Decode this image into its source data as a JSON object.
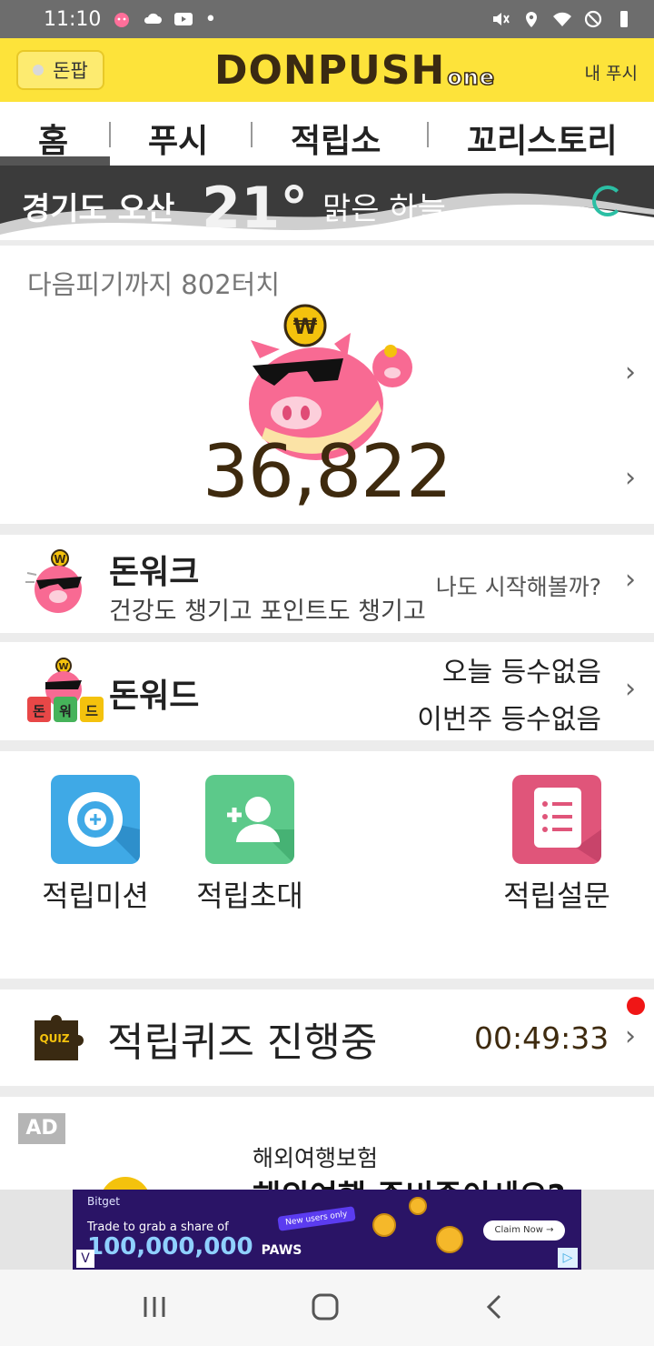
{
  "status_bar": {
    "time": "11:10",
    "notification_dot": "•"
  },
  "header": {
    "donpop_label": "돈팝",
    "logo_main": "DONPUSH",
    "logo_suffix": "one",
    "my_push_label": "내 푸시"
  },
  "tabs": [
    {
      "label": "홈",
      "active": true
    },
    {
      "label": "푸시"
    },
    {
      "label": "적립소"
    },
    {
      "label": "꼬리스토리"
    }
  ],
  "weather": {
    "location": "경기도 오산",
    "temperature": "21°",
    "description": "맑은 하늘"
  },
  "pig": {
    "next_pig_text": "다음피기까지 802터치",
    "points": "36,822",
    "coin_symbol": "₩"
  },
  "donwalk": {
    "title": "돈워크",
    "subtitle": "건강도 챙기고 포인트도 챙기고",
    "right_text": "나도 시작해볼까?",
    "coin_symbol": "W"
  },
  "donword": {
    "title": "돈워드",
    "today_text": "오늘 등수없음",
    "week_text": "이번주 등수없음",
    "tiles": [
      "돈",
      "워",
      "드"
    ],
    "coin_symbol": "W"
  },
  "earn_items": [
    {
      "label": "적립미션"
    },
    {
      "label": "적립초대"
    },
    {
      "label": "적립설문"
    }
  ],
  "quiz": {
    "badge": "QUIZ",
    "title": "적립퀴즈 진행중",
    "timer": "00:49:33"
  },
  "ad": {
    "label": "AD",
    "category": "해외여행보험",
    "headline": "해외여행 준비중이세요?"
  },
  "banner": {
    "brand": "Bitget",
    "line1": "Trade to grab a share of",
    "amount": "100,000,000",
    "unit": "PAWS",
    "pill": "New users only",
    "claim": "Claim Now →"
  },
  "colors": {
    "header_yellow": "#fde33a",
    "mission_blue": "#3fa9e6",
    "invite_green": "#5cc98a",
    "survey_pink": "#e0557a",
    "brown_text": "#3e2a0e"
  }
}
